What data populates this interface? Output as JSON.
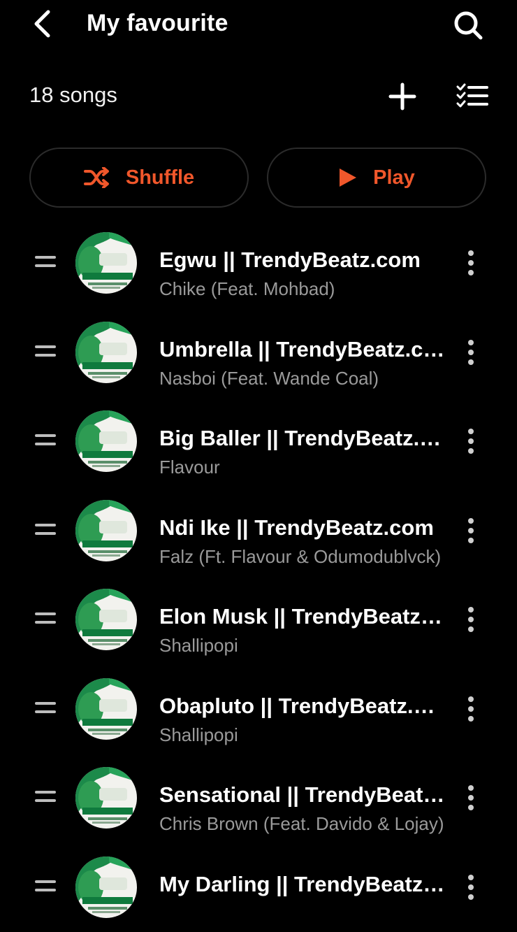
{
  "header": {
    "title": "My favourite"
  },
  "toolbar": {
    "count": "18 songs"
  },
  "actions": {
    "shuffle_label": "Shuffle",
    "play_label": "Play"
  },
  "colors": {
    "accent": "#f0572b",
    "background": "#000000",
    "secondary_text": "#9a9a9a"
  },
  "icons": [
    "back-arrow-icon",
    "search-icon",
    "add-icon",
    "multi-select-icon",
    "shuffle-icon",
    "play-icon",
    "drag-handle-icon",
    "more-vertical-icon"
  ],
  "songs": [
    {
      "title": "Egwu || TrendyBeatz.com",
      "artist": "Chike (Feat. Mohbad)"
    },
    {
      "title": "Umbrella || TrendyBeatz.com",
      "artist": "Nasboi (Feat. Wande Coal)"
    },
    {
      "title": "Big Baller || TrendyBeatz.com",
      "artist": "Flavour"
    },
    {
      "title": "Ndi Ike || TrendyBeatz.com",
      "artist": "Falz (Ft. Flavour & Odumodublvck)"
    },
    {
      "title": "Elon Musk || TrendyBeatz.com",
      "artist": "Shallipopi"
    },
    {
      "title": "Obapluto || TrendyBeatz.com",
      "artist": "Shallipopi"
    },
    {
      "title": "Sensational || TrendyBeatz.com",
      "artist": "Chris Brown (Feat. Davido & Lojay)"
    },
    {
      "title": "My Darling || TrendyBeatz.com",
      "artist": ""
    }
  ]
}
